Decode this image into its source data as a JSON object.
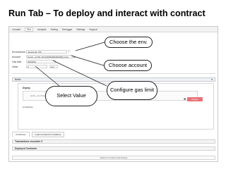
{
  "slide": {
    "title": "Run Tab – To deploy and interact with contract"
  },
  "menu": {
    "items": [
      "Compile",
      "Run",
      "Analysis",
      "Testing",
      "Debugger",
      "Settings",
      "Support"
    ],
    "active": "Run"
  },
  "form": {
    "environment": {
      "label": "Environment",
      "value": "JavaScript VM"
    },
    "account": {
      "label": "Account",
      "value": "0xca3...a733c (99.999999999999998) ether"
    },
    "gas_limit": {
      "label": "Gas limit",
      "value": "3000000"
    },
    "value": {
      "label": "Value",
      "value": "0",
      "unit": "wei"
    }
  },
  "deploy": {
    "selected_contract": "Ballot",
    "panel_label": "Deploy",
    "constructor_placeholder": "uint8 _numProposals",
    "button_label": "Deploy",
    "link_text": "At Address"
  },
  "lower_tabs": [
    "At Address",
    "Load contract from Address"
  ],
  "sections": {
    "transactions": "Transactions recorded: 0",
    "deployed": "Deployed Contracts"
  },
  "status_text": "Select a Contract and Deploy",
  "callouts": {
    "env": "Choose the env.",
    "account": "Choose account",
    "gas": "Configure gas limit",
    "value": "Select Value"
  },
  "colors": {
    "deploy_button": "#e8737a",
    "callout_border": "#222222"
  }
}
